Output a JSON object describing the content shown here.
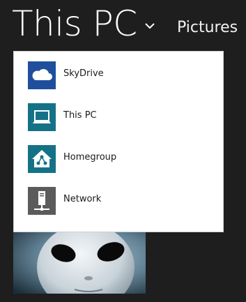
{
  "header": {
    "title": "This PC",
    "breadcrumb": "Pictures"
  },
  "dropdown": {
    "items": [
      {
        "label": "SkyDrive",
        "icon": "cloud-icon",
        "color": "#1f4f9c"
      },
      {
        "label": "This PC",
        "icon": "laptop-icon",
        "color": "#157286"
      },
      {
        "label": "Homegroup",
        "icon": "homegroup-icon",
        "color": "#157286"
      },
      {
        "label": "Network",
        "icon": "network-icon",
        "color": "#5b5b5b"
      }
    ]
  },
  "colors": {
    "background": "#1e1e1e",
    "text": "#ffffff"
  }
}
